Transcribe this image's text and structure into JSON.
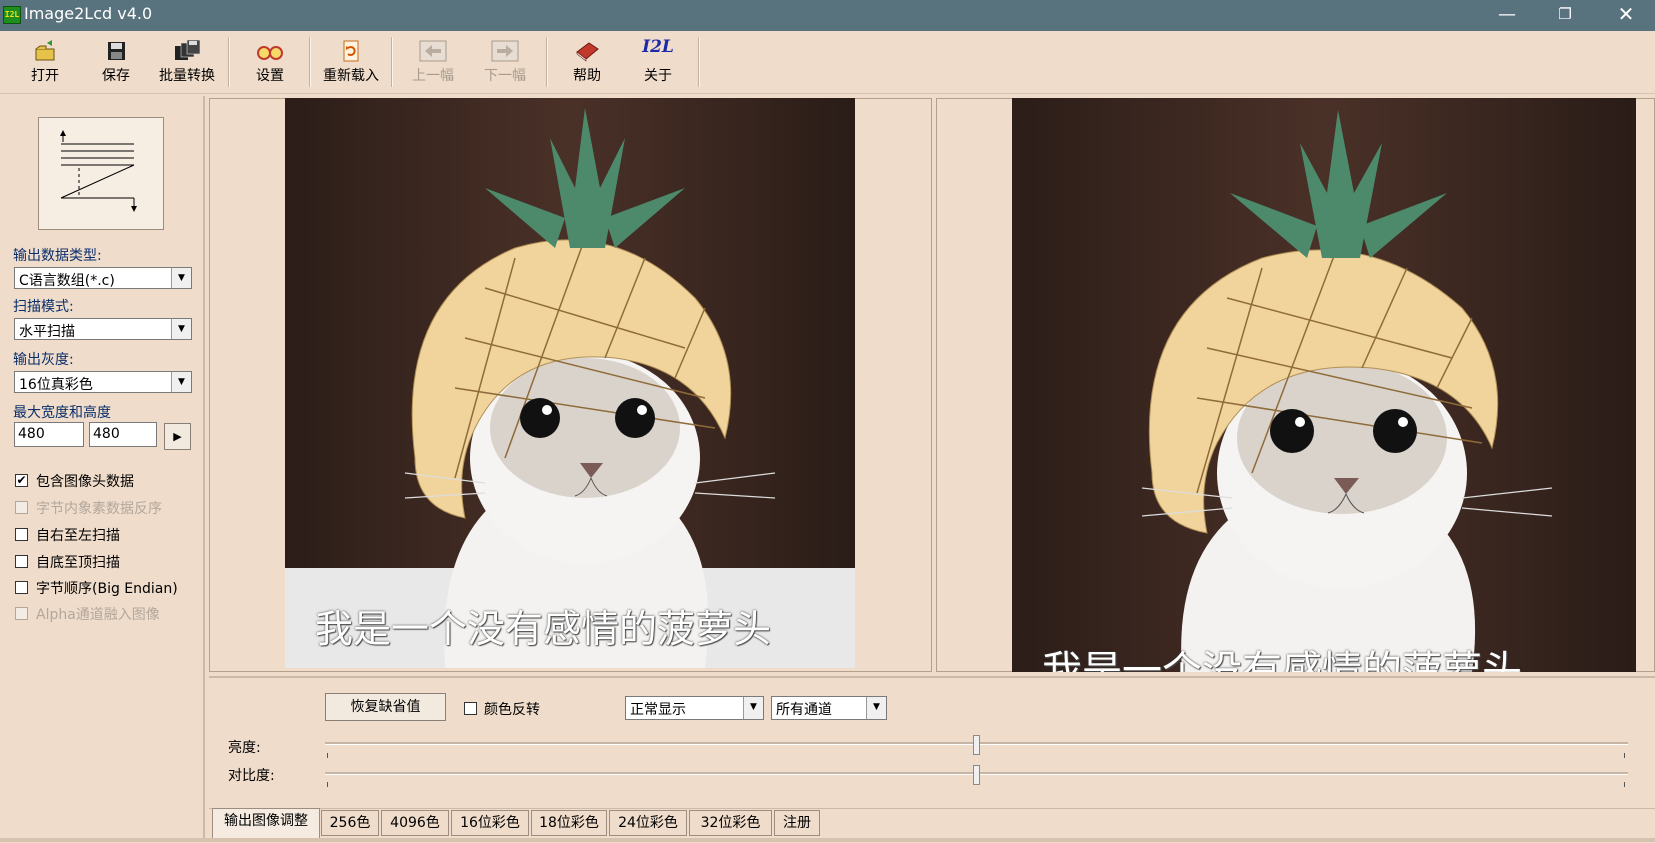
{
  "window": {
    "logo_text": "I2L",
    "title": "Image2Lcd v4.0",
    "minimize_glyph": "—",
    "maximize_glyph": "❐",
    "close_glyph": "✕"
  },
  "toolbar": {
    "open": "打开",
    "save": "保存",
    "batch": "批量转换",
    "settings": "设置",
    "reload": "重新载入",
    "prev": "上一幅",
    "next": "下一幅",
    "help": "帮助",
    "about": "关于",
    "about_icon_text": "I2L"
  },
  "left": {
    "output_type_label": "输出数据类型:",
    "output_type_value": "C语言数组(*.c)",
    "scan_mode_label": "扫描模式:",
    "scan_mode_value": "水平扫描",
    "gray_label": "输出灰度:",
    "gray_value": "16位真彩色",
    "size_label": "最大宽度和高度",
    "max_width": "480",
    "max_height": "480",
    "size_apply_glyph": "▶",
    "checkboxes": [
      {
        "label": "包含图像头数据",
        "checked": true,
        "enabled": true
      },
      {
        "label": "字节内象素数据反序",
        "checked": false,
        "enabled": false
      },
      {
        "label": "自右至左扫描",
        "checked": false,
        "enabled": true
      },
      {
        "label": "自底至顶扫描",
        "checked": false,
        "enabled": true
      },
      {
        "label": "字节顺序(Big Endian)",
        "checked": false,
        "enabled": true
      },
      {
        "label": "Alpha通道融入图像",
        "checked": false,
        "enabled": false
      }
    ],
    "check_glyph": "✔"
  },
  "preview": {
    "caption": "我是一个没有感情的菠萝头"
  },
  "adjust": {
    "restore_default": "恢复缺省值",
    "invert_label": "颜色反转",
    "display_mode": "正常显示",
    "channel": "所有通道",
    "brightness_label": "亮度:",
    "contrast_label": "对比度:",
    "brightness_level": 0.5,
    "contrast_level": 0.5
  },
  "tabs": [
    "输出图像调整",
    "256色",
    "4096色",
    "16位彩色",
    "18位彩色",
    "24位彩色",
    "32位彩色",
    "注册"
  ],
  "colors": {
    "titlebar": "#58727e",
    "background": "#efdcca",
    "label_blue": "#0b2f6b"
  }
}
